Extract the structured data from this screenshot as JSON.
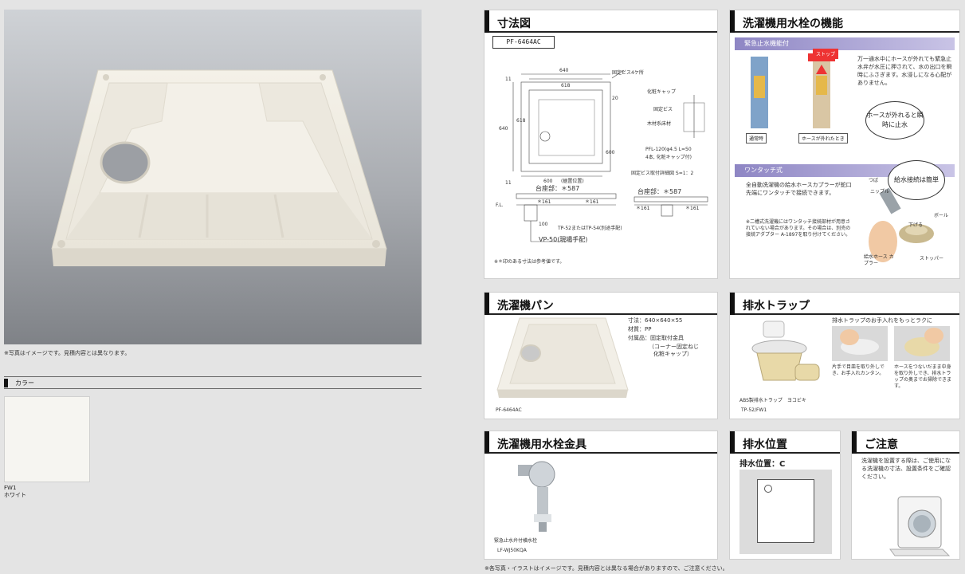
{
  "left": {
    "photo_note": "※写真はイメージです。見積内容とは異なります。",
    "color_heading": "カラー",
    "swatch_code": "FW1",
    "swatch_name": "ホワイト"
  },
  "dimensions": {
    "title": "寸法図",
    "model": "PF-6464AC",
    "labels": {
      "w640": "640",
      "w618": "618",
      "d11a": "11",
      "d11b": "11",
      "d20": "20",
      "h640": "640",
      "h618": "618",
      "h600": "600",
      "w600": "600",
      "w600_note": "(据置位置)",
      "fix_screws": "固定ビス4ケ所",
      "cap": "化粧キャップ",
      "screw": "固定ビス",
      "floor": "木材系床材",
      "pfl": "PFL-120(φ4.5 L=50",
      "pfl2": "4本, 化粧キャップ付)",
      "detail": "固定ビス取付詳細図 S=1：2",
      "base1": "台座部：＊587",
      "base2": "台座部：＊587",
      "d161a": "＊161",
      "d161b": "＊161",
      "d161c": "＊161",
      "d161d": "＊161",
      "fl": "F.L.",
      "tp": "TP-52またはTP-54(別途手配)",
      "vp": "VP-50(現場手配)",
      "d100": "100"
    },
    "note": "※＊印のある寸法は参考値です。"
  },
  "faucet": {
    "title": "洗濯機用水栓の機能",
    "section1": "緊急止水機能付",
    "stop": "ストップ",
    "desc1": "万一通水中にホースが外れても緊急止水弁が水圧に押されて、水の出口を瞬時にふさぎます。水浸しになる心配がありません。",
    "bubble1": "ホースが外れると瞬時に止水",
    "caption_normal": "通常時",
    "caption_off": "ホースが外れたとき",
    "section2": "ワンタッチ式",
    "bubble2": "給水接続は簡単",
    "desc2": "全自動洗濯機の給水ホースカプラーが蛇口先端にワンタッチで接続できます。",
    "note2": "※二槽式洗濯機にはワンタッチ接続部材が用意されていない場合があります。その場合は、別売の接続アダプター A-1897を取り付けてください。",
    "tsuba": "つば",
    "nipple": "ニップル",
    "ball": "ボール",
    "pull": "下げる",
    "coupler": "給水ホース カプラー",
    "stopper": "ストッパー"
  },
  "pan": {
    "title": "洗濯機パン",
    "size": "寸法：640×640×55",
    "material": "材質：PP",
    "accessories": "付属品：固定取付金具",
    "acc2": "（コーナー固定ねじ",
    "acc3": "化粧キャップ）",
    "model": "PF-6464AC"
  },
  "trap": {
    "title": "排水トラップ",
    "lead": "排水トラップのお手入れをもっとラクに",
    "step1": "片手で目皿を取り外しでき、お手入れカンタン。",
    "step2": "ホースをつないだまま中身を取り外しでき、排水トラップの奥までお掃除できます。",
    "product": "ABS製排水トラップ　ヨコビキ",
    "code": "TP-52/FW1"
  },
  "fitting": {
    "title": "洗濯機用水栓金具",
    "product": "緊急止水弁付横水栓",
    "code": "LF-WJ50KQA"
  },
  "drainpos": {
    "title": "排水位置",
    "label": "排水位置：C"
  },
  "caution": {
    "title": "ご注意",
    "text": "洗濯機を設置する際は、ご使用になる洗濯機の寸法、設置条件をご確認ください。"
  },
  "footer": "※各写真・イラストはイメージです。見積内容とは異なる場合がありますので、ご注意ください。"
}
